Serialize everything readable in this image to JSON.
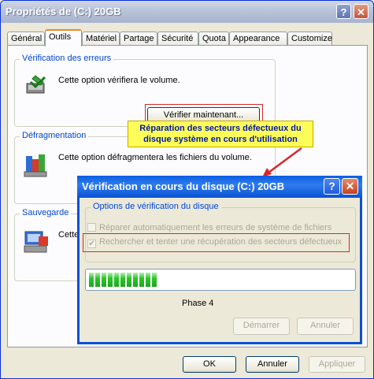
{
  "window": {
    "title": "Propriétés de (C:) 20GB",
    "help_glyph": "?",
    "close_glyph": "✕"
  },
  "tabs": [
    {
      "label": "Général"
    },
    {
      "label": "Outils"
    },
    {
      "label": "Matériel"
    },
    {
      "label": "Partage"
    },
    {
      "label": "Sécurité"
    },
    {
      "label": "Quota"
    },
    {
      "label": "Appearance"
    },
    {
      "label": "Customize"
    }
  ],
  "groups": {
    "error_check": {
      "title": "Vérification des erreurs",
      "text": "Cette option vérifiera le volume.",
      "button": "Vérifier maintenant..."
    },
    "defrag": {
      "title": "Défragmentation",
      "text": "Cette option défragmentera les fichiers du volume."
    },
    "backup": {
      "title": "Sauvegarde",
      "text": "Cette"
    }
  },
  "callout": {
    "line1": "Réparation des secteurs défectueux du",
    "line2": "disque système en cours d'utilisation"
  },
  "dialog": {
    "title": "Vérification en cours du disque (C:) 20GB",
    "help_glyph": "?",
    "close_glyph": "✕",
    "group_title": "Options de vérification du disque",
    "option1": "Réparer automatiquement les erreurs de système de fichiers",
    "option2": "Rechercher et tenter une récupération des secteurs défectueux",
    "option2_checked": true,
    "progress_fraction": 0.26,
    "phase": "Phase 4",
    "start_button": "Démarrer",
    "cancel_button": "Annuler"
  },
  "footer": {
    "ok": "OK",
    "cancel": "Annuler",
    "apply": "Appliquer"
  },
  "colors": {
    "accent": "#0a4fd6",
    "highlight": "#d82828",
    "callout_bg": "#fffe58"
  }
}
